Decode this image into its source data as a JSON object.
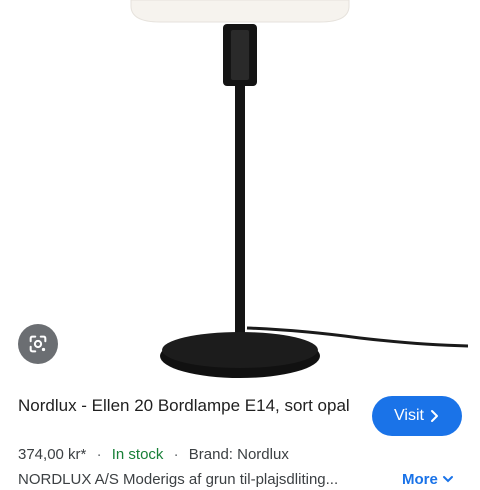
{
  "image": {
    "alt": "Nordlux Ellen 20 table lamp",
    "lens_icon": "google-lens-icon"
  },
  "product": {
    "title": "Nordlux - Ellen 20 Bordlampe E14, sort opal",
    "price": "374,00 kr*",
    "stock": "In stock",
    "brand": "Brand: Nordlux",
    "description": "NORDLUX A/S Moderigs af grun til-plajsdliting...",
    "more_label": "More",
    "more_icon": "chevron-down-icon"
  },
  "actions": {
    "visit_label": "Visit",
    "visit_icon": "chevron-right-icon"
  },
  "colors": {
    "accent": "#1a73e8",
    "stock": "#188038"
  }
}
